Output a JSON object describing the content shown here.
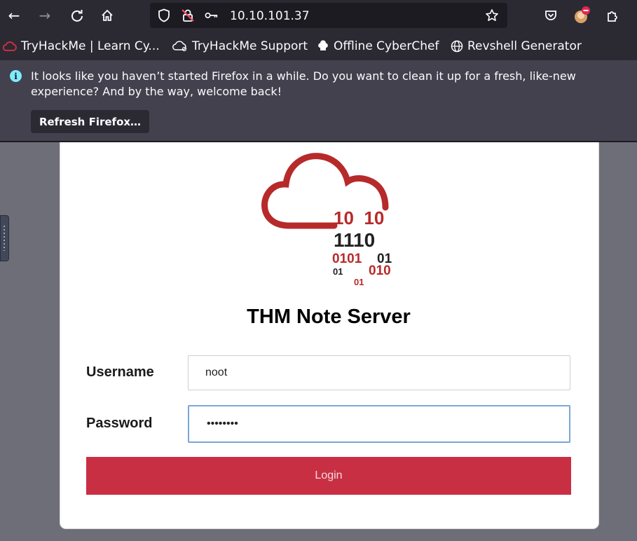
{
  "browser": {
    "url": "10.10.101.37",
    "bookmarks": [
      {
        "label": "TryHackMe | Learn Cy..."
      },
      {
        "label": "TryHackMe Support"
      },
      {
        "label": "Offline CyberChef"
      },
      {
        "label": "Revshell Generator"
      }
    ],
    "notification": {
      "message": "It looks like you haven’t started Firefox in a while. Do you want to clean it up for a fresh, like-new experience? And by the way, welcome back!",
      "button_label": "Refresh Firefox…"
    }
  },
  "page": {
    "logo_digits": {
      "row1": "10  10",
      "row2": "1110",
      "row3_left": "0101",
      "row3_right": "01",
      "row4_left": "01",
      "row4_right": "010",
      "row5": "01"
    },
    "title": "THM Note Server",
    "form": {
      "username_label": "Username",
      "username_value": "noot",
      "password_label": "Password",
      "password_value": "••••••••",
      "login_label": "Login"
    }
  },
  "colors": {
    "brand_red": "#c92f43",
    "logo_red": "#b72a2a",
    "chrome_dark": "#2b2a33",
    "notice_bg": "#42414d"
  }
}
